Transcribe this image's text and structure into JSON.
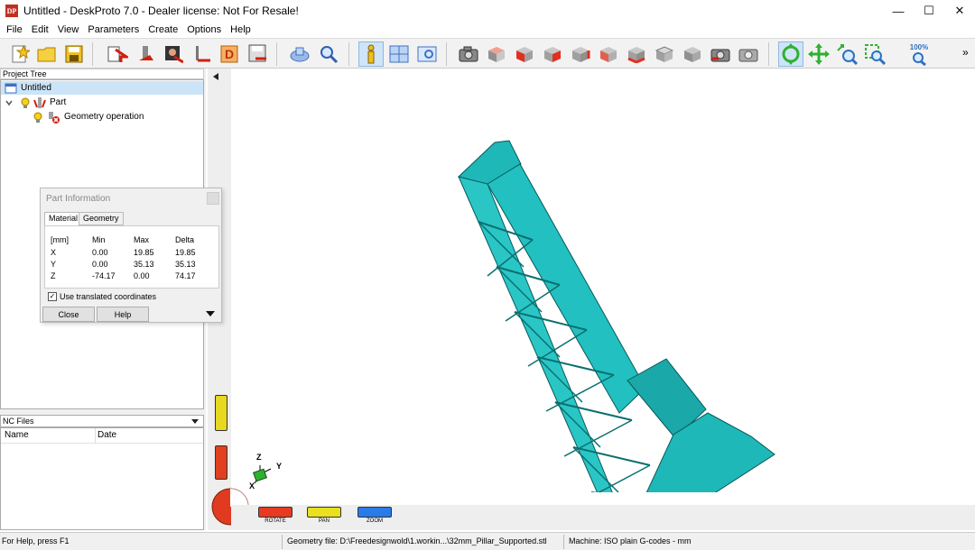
{
  "window": {
    "title": "Untitled - DeskProto 7.0 - Dealer license: Not For Resale!",
    "app_icon": "DP"
  },
  "window_controls": {
    "minimize": "—",
    "maximize": "☐",
    "close": "✕"
  },
  "menu": [
    "File",
    "Edit",
    "View",
    "Parameters",
    "Create",
    "Options",
    "Help"
  ],
  "toolbar": {
    "zoom_label": "100%",
    "more": "»"
  },
  "project_tree": {
    "header": "Project Tree",
    "items": [
      {
        "label": "Untitled",
        "icon": "project-icon"
      },
      {
        "label": "Part",
        "icon": "part-icon"
      },
      {
        "label": "Geometry operation",
        "icon": "geometry-operation-icon"
      }
    ]
  },
  "nc_files": {
    "header": "NC Files",
    "columns": [
      "Name",
      "Date"
    ]
  },
  "part_info": {
    "title": "Part Information",
    "tabs": [
      "Material",
      "Geometry"
    ],
    "table": {
      "headers": [
        "[mm]",
        "Min",
        "Max",
        "Delta"
      ],
      "rows": [
        [
          "X",
          "0.00",
          "19.85",
          "19.85"
        ],
        [
          "Y",
          "0.00",
          "35.13",
          "35.13"
        ],
        [
          "Z",
          "-74.17",
          "0.00",
          "74.17"
        ]
      ]
    },
    "checkbox_label": "Use translated coordinates",
    "checkbox_checked": true,
    "close_label": "Close",
    "help_label": "Help"
  },
  "viewport": {
    "axes": {
      "x": "X",
      "y": "Y",
      "z": "Z"
    },
    "nav": [
      {
        "label": "ROTATE",
        "color": "#e83a20"
      },
      {
        "label": "PAN",
        "color": "#e8e020"
      },
      {
        "label": "ZOOM",
        "color": "#2a7ae8"
      }
    ],
    "model_color": "#1fb8b8"
  },
  "status": {
    "help": "For Help, press F1",
    "geometry_file": "Geometry file: D:\\Freedesignwold\\1.workin...\\32mm_Pillar_Supported.stl",
    "machine": "Machine: ISO plain G-codes - mm"
  }
}
